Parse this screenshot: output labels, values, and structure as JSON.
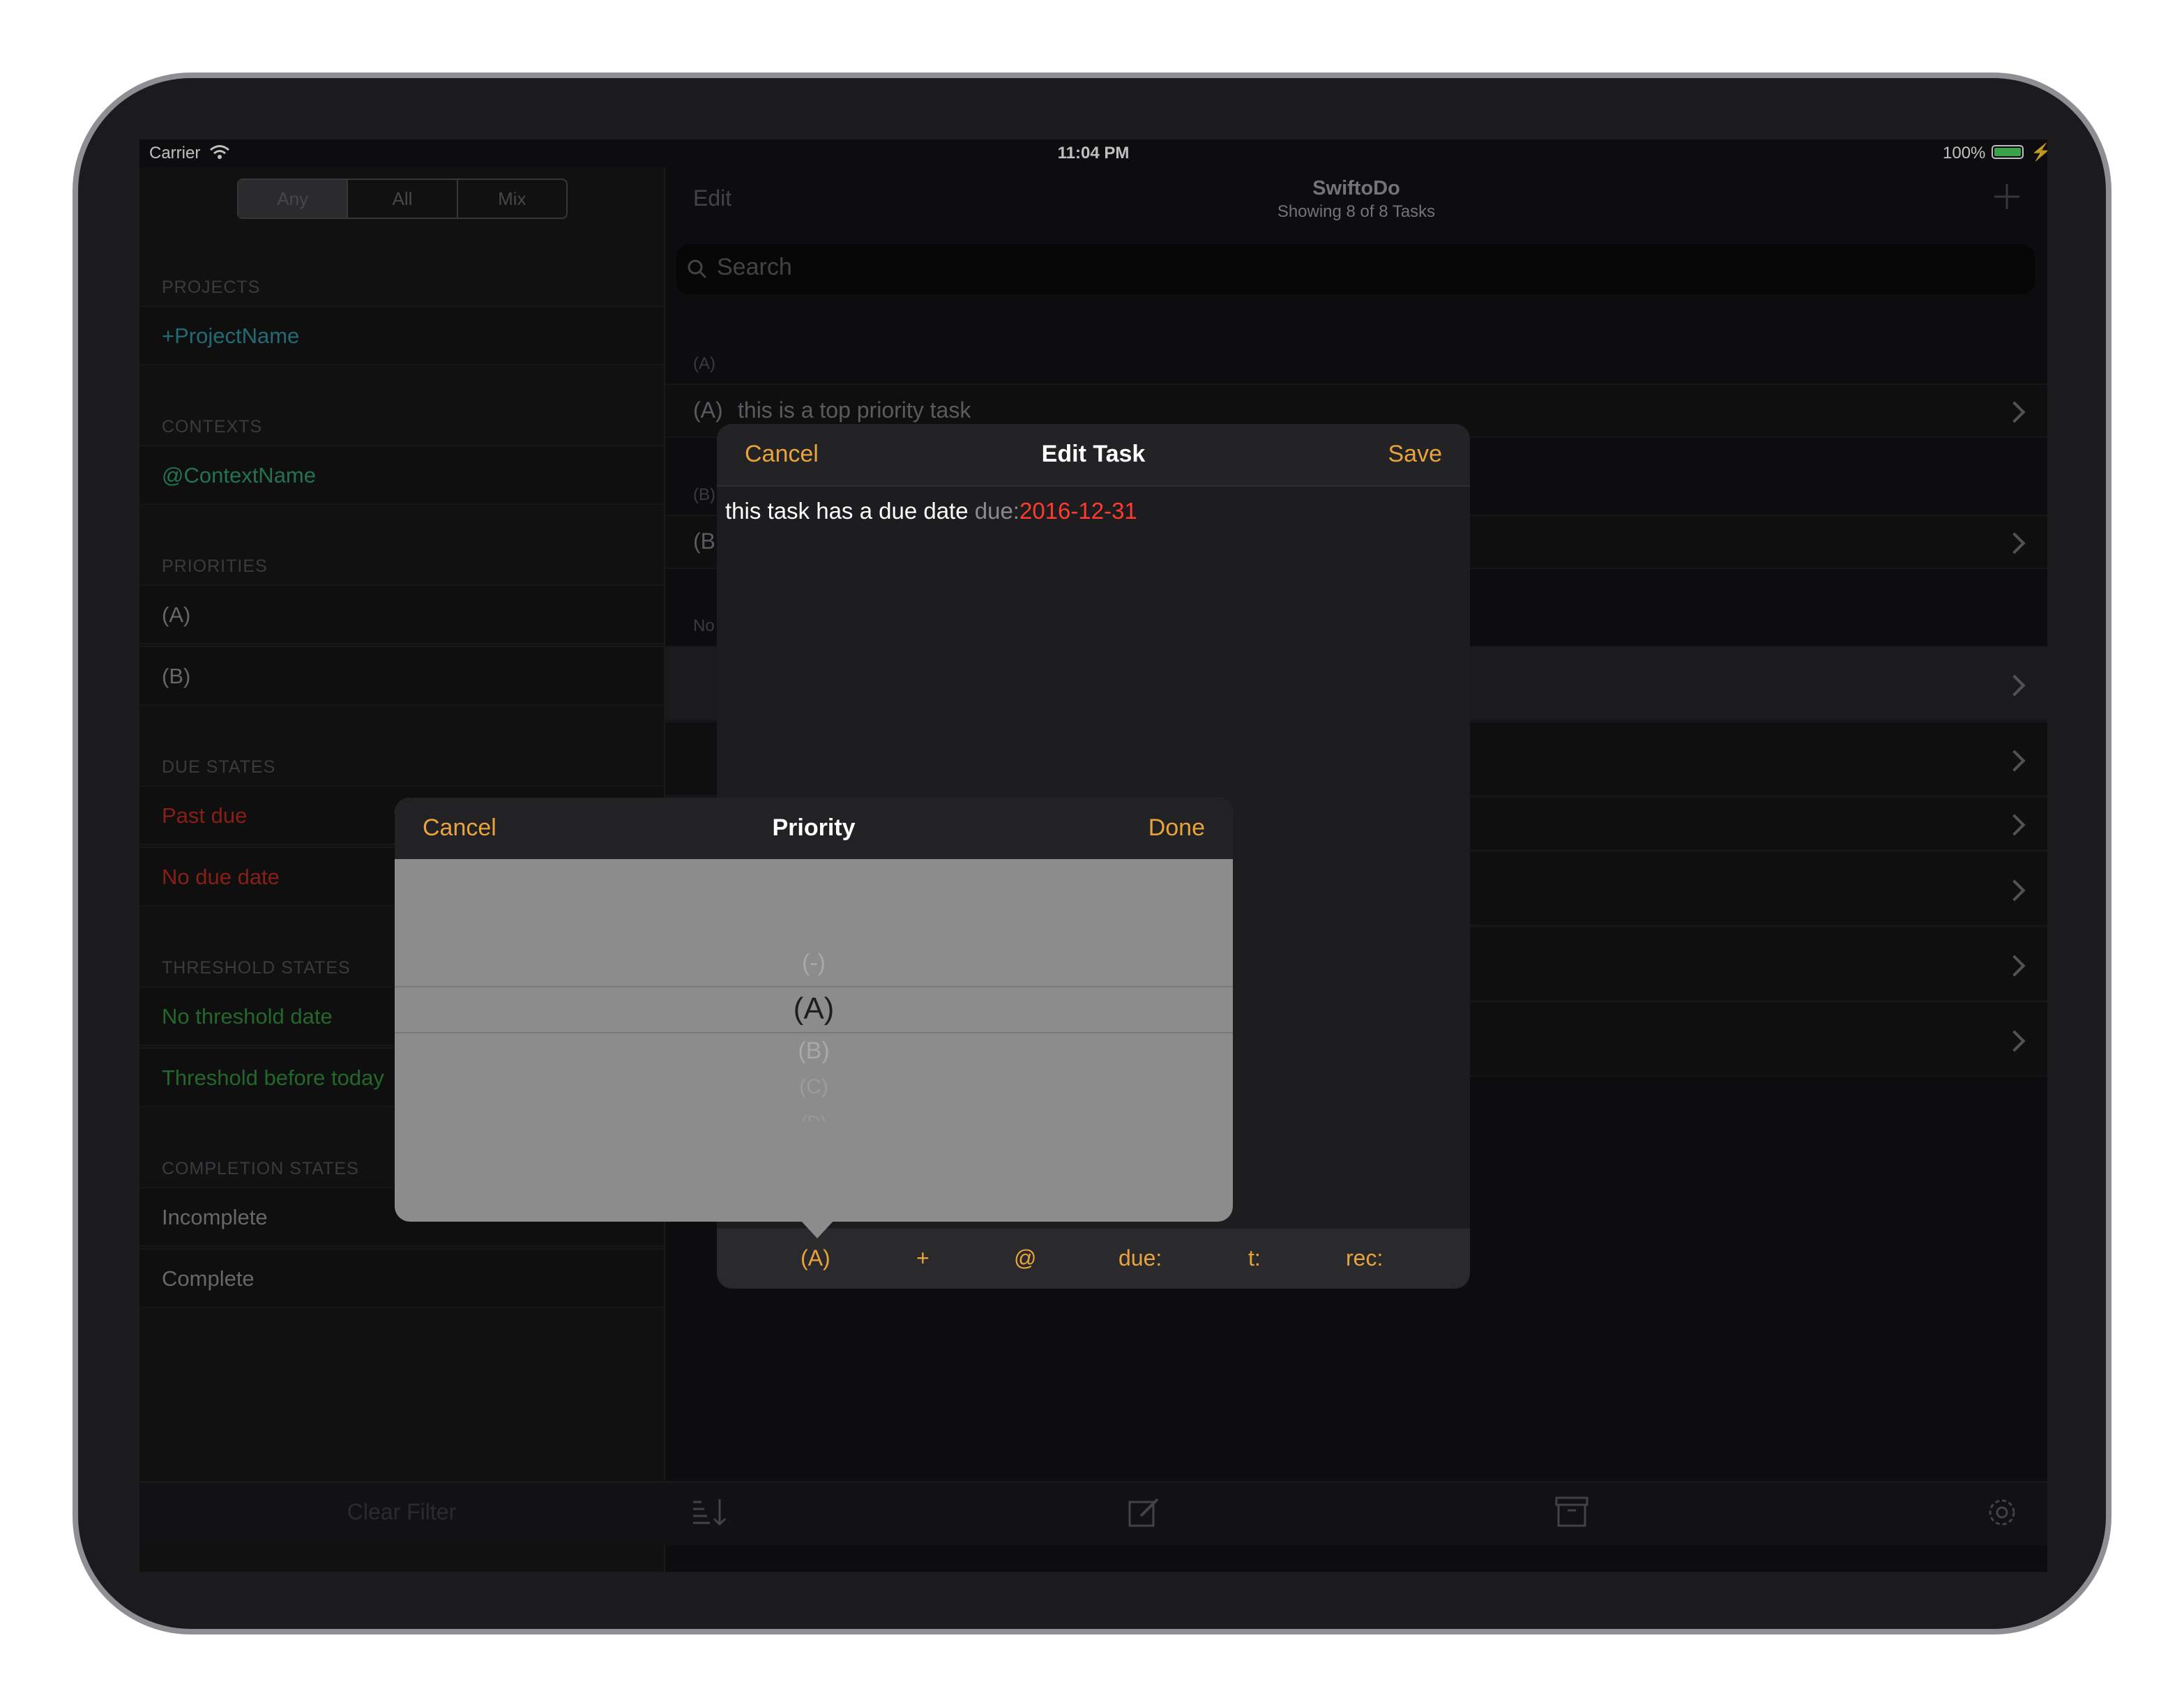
{
  "status": {
    "carrier": "Carrier",
    "time": "11:04 PM",
    "battery": "100%"
  },
  "sidebar": {
    "segments": [
      "Any",
      "All",
      "Mix"
    ],
    "sections": [
      {
        "header": "PROJECTS",
        "items": [
          "+ProjectName"
        ]
      },
      {
        "header": "CONTEXTS",
        "items": [
          "@ContextName"
        ]
      },
      {
        "header": "PRIORITIES",
        "items": [
          "(A)",
          "(B)"
        ]
      },
      {
        "header": "DUE STATES",
        "items": [
          "Past due",
          "No due date"
        ]
      },
      {
        "header": "THRESHOLD STATES",
        "items": [
          "No threshold date",
          "Threshold before today"
        ]
      },
      {
        "header": "COMPLETION STATES",
        "items": [
          "Incomplete",
          "Complete"
        ]
      }
    ],
    "clear_filter": "Clear Filter"
  },
  "main": {
    "edit": "Edit",
    "title": "SwiftoDo",
    "subtitle": "Showing 8 of 8 Tasks",
    "search_placeholder": "Search",
    "group_a": "(A)",
    "task_a_priority": "(A)",
    "task_a_text": "this is a top priority task",
    "group_b": "(B)",
    "task_b_partial": "(B",
    "group_none_partial": "No"
  },
  "edit_task": {
    "cancel": "Cancel",
    "title": "Edit Task",
    "save": "Save",
    "text_plain": "this task has a due date ",
    "text_key": "due:",
    "text_date": "2016-12-31",
    "accessory": [
      "(A)",
      "+",
      "@",
      "due:",
      "t:",
      "rec:"
    ]
  },
  "priority_picker": {
    "cancel": "Cancel",
    "title": "Priority",
    "done": "Done",
    "options": [
      "(-)",
      "(A)",
      "(B)",
      "(C)",
      "(D)"
    ],
    "selected": "(A)"
  },
  "colors": {
    "accent": "#e8a33d",
    "project": "#2f8f9a",
    "context": "#2e9a6a",
    "due": "#b52a1e",
    "threshold": "#2f8a3a",
    "date_red": "#ff3b30"
  }
}
